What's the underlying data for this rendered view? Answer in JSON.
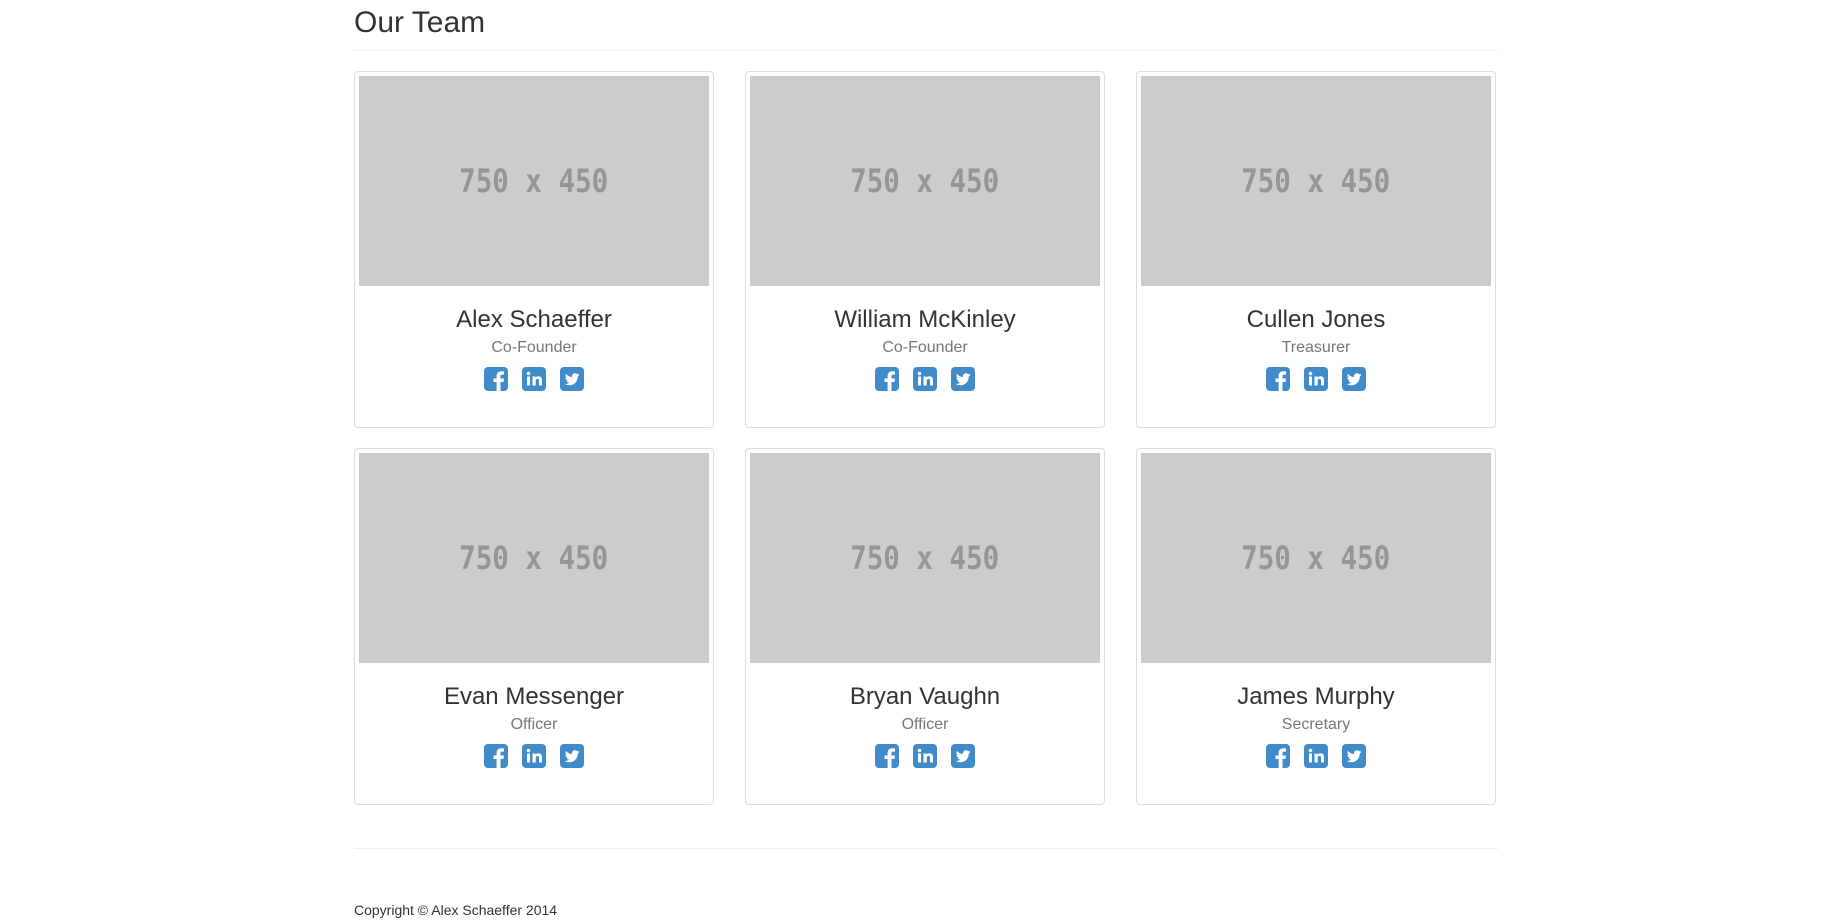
{
  "header": {
    "title": "Our Team"
  },
  "placeholder_text": "750 x 450",
  "members": [
    {
      "name": "Alex Schaeffer",
      "role": "Co-Founder"
    },
    {
      "name": "William McKinley",
      "role": "Co-Founder"
    },
    {
      "name": "Cullen Jones",
      "role": "Treasurer"
    },
    {
      "name": "Evan Messenger",
      "role": "Officer"
    },
    {
      "name": "Bryan Vaughn",
      "role": "Officer"
    },
    {
      "name": "James Murphy",
      "role": "Secretary"
    }
  ],
  "social_icons": [
    "facebook-icon",
    "linkedin-icon",
    "twitter-icon"
  ],
  "footer": {
    "copyright": "Copyright © Alex Schaeffer 2014"
  },
  "colors": {
    "icon_blue": "#428bca",
    "placeholder_bg": "#cccccc",
    "placeholder_text": "#969696"
  }
}
